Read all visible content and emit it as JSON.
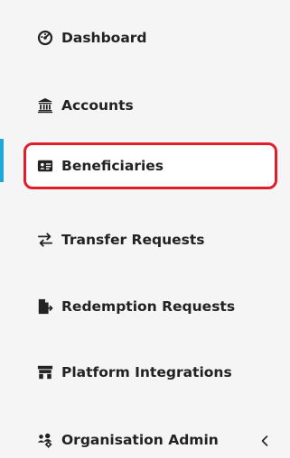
{
  "sidebar": {
    "items": [
      {
        "label": "Dashboard",
        "icon": "dashboard-icon"
      },
      {
        "label": "Accounts",
        "icon": "bank-icon"
      },
      {
        "label": "Beneficiaries",
        "icon": "id-card-icon",
        "active": true
      },
      {
        "label": "Transfer Requests",
        "icon": "transfer-arrows-icon"
      },
      {
        "label": "Redemption Requests",
        "icon": "file-export-icon"
      },
      {
        "label": "Platform Integrations",
        "icon": "integration-icon"
      },
      {
        "label": "Organisation Admin",
        "icon": "users-cog-icon",
        "expandable": true
      }
    ],
    "active_color": "#1ea8d8",
    "highlight_color": "#e11d2a"
  }
}
